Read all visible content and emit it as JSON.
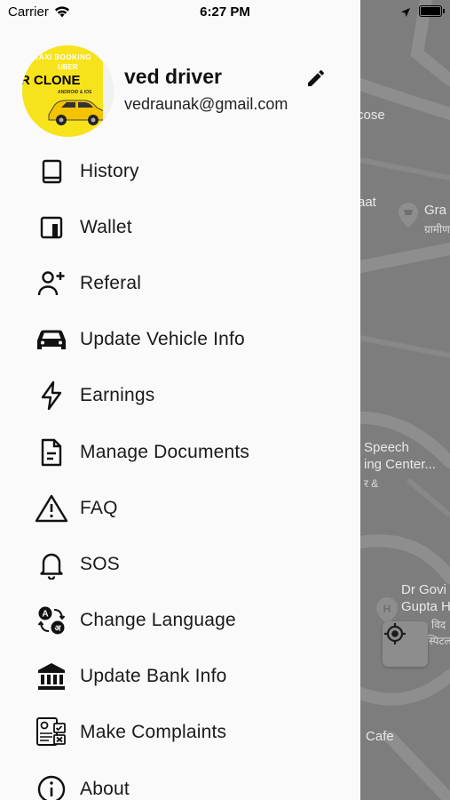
{
  "status_bar": {
    "carrier": "Carrier",
    "time": "6:27 PM"
  },
  "profile": {
    "name": "ved driver",
    "email": "vedraunak@gmail.com",
    "avatar_text": [
      "TAXI BOOKING",
      "UBER",
      "R CLONE",
      "ANDROID & IOS"
    ]
  },
  "menu": {
    "items": [
      {
        "label": "History",
        "icon": "book-icon"
      },
      {
        "label": "Wallet",
        "icon": "wallet-icon"
      },
      {
        "label": "Referal",
        "icon": "person-add-icon"
      },
      {
        "label": "Update Vehicle Info",
        "icon": "car-icon"
      },
      {
        "label": "Earnings",
        "icon": "lightning-icon"
      },
      {
        "label": "Manage Documents",
        "icon": "document-icon"
      },
      {
        "label": "FAQ",
        "icon": "warning-icon"
      },
      {
        "label": "SOS",
        "icon": "bell-icon"
      },
      {
        "label": "Change Language",
        "icon": "translate-icon"
      },
      {
        "label": "Update Bank Info",
        "icon": "bank-icon"
      },
      {
        "label": "Make Complaints",
        "icon": "complaint-form-icon"
      },
      {
        "label": "About",
        "icon": "info-icon"
      }
    ]
  },
  "map": {
    "labels": [
      "cose",
      "aat",
      "Gra",
      "ग्रामीण",
      "Speech",
      "ing Center...",
      "र &",
      "Dr Govi",
      "Gupta H",
      "विद",
      "स्पिटल",
      "Cafe"
    ]
  },
  "colors": {
    "drawer_bg": "#fafafa",
    "map_dim": "#7d7d7d",
    "avatar_yellow": "#f7e31c",
    "text": "#1a1a1a"
  }
}
